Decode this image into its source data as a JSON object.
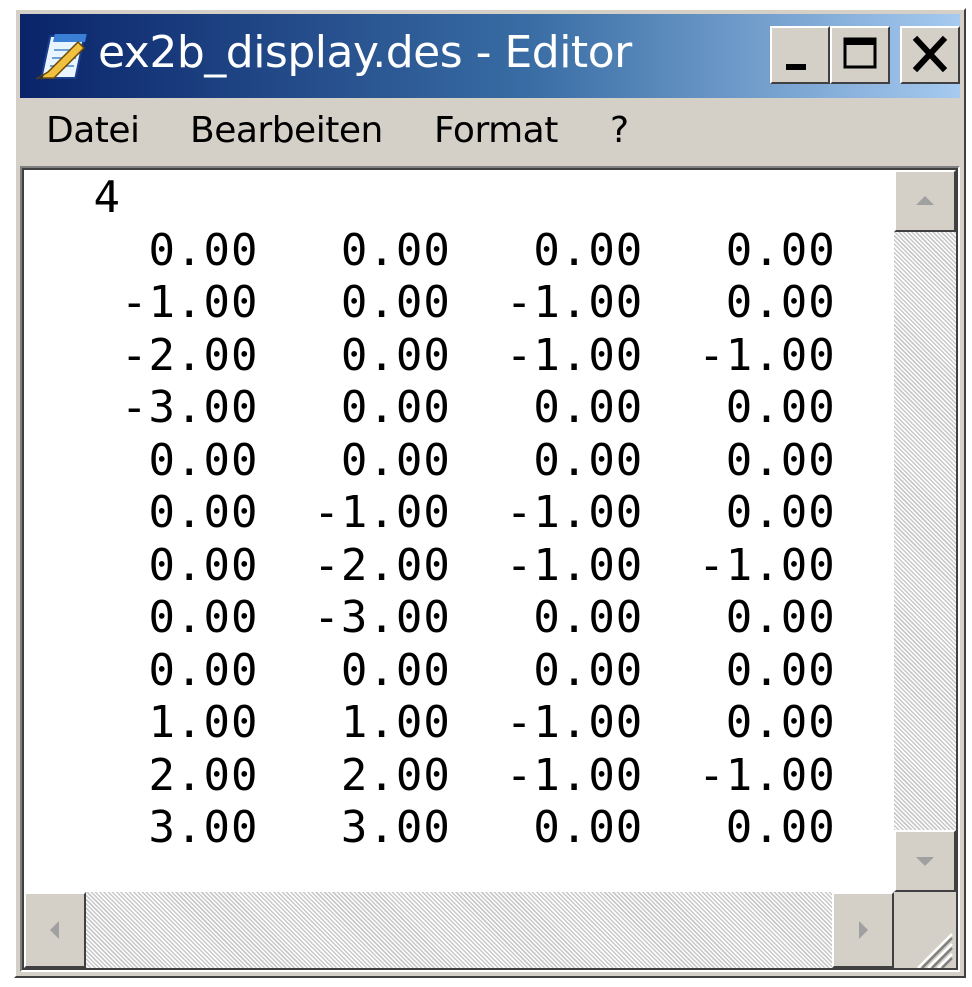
{
  "window": {
    "title": "ex2b_display.des - Editor",
    "icon": "notepad-icon"
  },
  "title_buttons": {
    "minimize": "minimize-icon",
    "maximize": "maximize-icon",
    "close": "close-icon"
  },
  "menu": {
    "items": [
      {
        "label": "Datei"
      },
      {
        "label": "Bearbeiten"
      },
      {
        "label": "Format"
      },
      {
        "label": "?"
      }
    ]
  },
  "editor": {
    "content": " 4\n   0.00   0.00   0.00   0.00\n  -1.00   0.00  -1.00   0.00\n  -2.00   0.00  -1.00  -1.00\n  -3.00   0.00   0.00   0.00\n   0.00   0.00   0.00   0.00\n   0.00  -1.00  -1.00   0.00\n   0.00  -2.00  -1.00  -1.00\n   0.00  -3.00   0.00   0.00\n   0.00   0.00   0.00   0.00\n   1.00   1.00  -1.00   0.00\n   2.00   2.00  -1.00  -1.00\n   3.00   3.00   0.00   0.00"
  },
  "scrollbars": {
    "vertical": {
      "up": "arrow-up-icon",
      "down": "arrow-down-icon"
    },
    "horizontal": {
      "left": "arrow-left-icon",
      "right": "arrow-right-icon"
    },
    "grip": "size-grip-icon"
  },
  "colors": {
    "titlebar_start": "#0a246a",
    "titlebar_end": "#a6caf0",
    "face": "#d4d0c8",
    "editor_bg": "#ffffff",
    "text": "#000000"
  }
}
